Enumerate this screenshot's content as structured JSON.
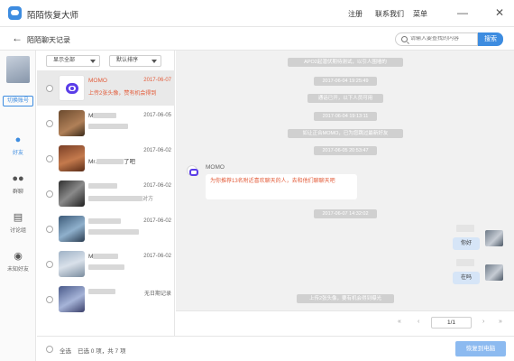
{
  "app": {
    "title": "陌陌恢复大师",
    "menu": [
      "注册",
      "联系我们",
      "菜单"
    ],
    "minimize": "—",
    "close": "✕"
  },
  "subheader": {
    "back": "←",
    "title": "陌陌聊天记录",
    "search_placeholder": "请输入要查找的内容",
    "search_button": "搜索"
  },
  "sidebar": {
    "switch_account": "切换账号",
    "items": [
      {
        "label": "好友",
        "icon": "person-icon"
      },
      {
        "label": "群聊",
        "icon": "group-icon"
      },
      {
        "label": "讨论组",
        "icon": "discussion-icon"
      },
      {
        "label": "未知好友",
        "icon": "unknown-friend-icon"
      }
    ]
  },
  "list": {
    "filter_show": "显示全部",
    "filter_sort": "默认排序",
    "contacts": [
      {
        "name": "MOMO",
        "date": "2017-06-07",
        "preview": "上传2张头像，赞有机会得到",
        "selected": true
      },
      {
        "name": "M",
        "date": "2017-06-05",
        "preview": "",
        "selected": false
      },
      {
        "name": "Mr.",
        "date": "2017-06-02",
        "preview": "了吧",
        "selected": false
      },
      {
        "name": "",
        "date": "2017-06-02",
        "preview": "对方",
        "selected": false
      },
      {
        "name": "",
        "date": "2017-06-02",
        "preview": "",
        "selected": false
      },
      {
        "name": "M",
        "date": "2017-06-02",
        "preview": "",
        "selected": false
      },
      {
        "name": "",
        "date": "无日期记录",
        "preview": "",
        "selected": false
      }
    ]
  },
  "chat": {
    "system_messages": [
      "APO2起潜伏期待测试，以引人围墙的",
      "2017-06-04 19:25:49",
      "通话已开，以下人员可用",
      "2017-06-04 19:13:11",
      "如让正合MOMO，已为您跳过最新好友",
      "2017-06-05 20:53:47",
      "2017-06-07 14:32:02",
      "上传2张头像，要有机会得到曝光"
    ],
    "incoming": {
      "sender": "MOMO",
      "text": "为你推荐13名附近喜欢聊天的人，去和他们聊聊天吧"
    },
    "outgoing": [
      "你好",
      "在吗"
    ]
  },
  "pager": {
    "first": "«",
    "prev": "‹",
    "page": "1/1",
    "next": "›",
    "last": "»"
  },
  "footer": {
    "select_all": "全选",
    "selected_count": "已选 0 项，共 7 项",
    "recover_button": "恢复到电脑"
  },
  "colors": {
    "accent": "#3d8ce0",
    "highlight_text": "#e35c3a",
    "momo_purple": "#5a3de8"
  }
}
